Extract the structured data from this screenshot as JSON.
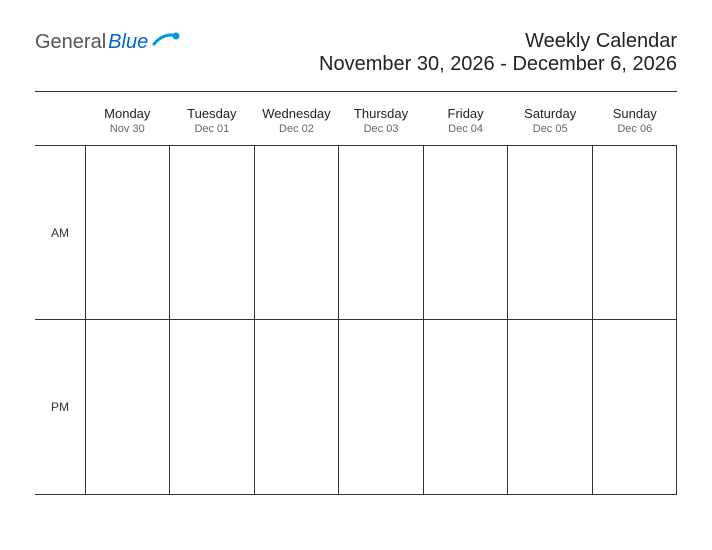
{
  "logo": {
    "text1": "General",
    "text2": "Blue"
  },
  "header": {
    "title": "Weekly Calendar",
    "date_range": "November 30, 2026 - December 6, 2026"
  },
  "days": [
    {
      "name": "Monday",
      "date": "Nov 30"
    },
    {
      "name": "Tuesday",
      "date": "Dec 01"
    },
    {
      "name": "Wednesday",
      "date": "Dec 02"
    },
    {
      "name": "Thursday",
      "date": "Dec 03"
    },
    {
      "name": "Friday",
      "date": "Dec 04"
    },
    {
      "name": "Saturday",
      "date": "Dec 05"
    },
    {
      "name": "Sunday",
      "date": "Dec 06"
    }
  ],
  "time_periods": [
    "AM",
    "PM"
  ]
}
